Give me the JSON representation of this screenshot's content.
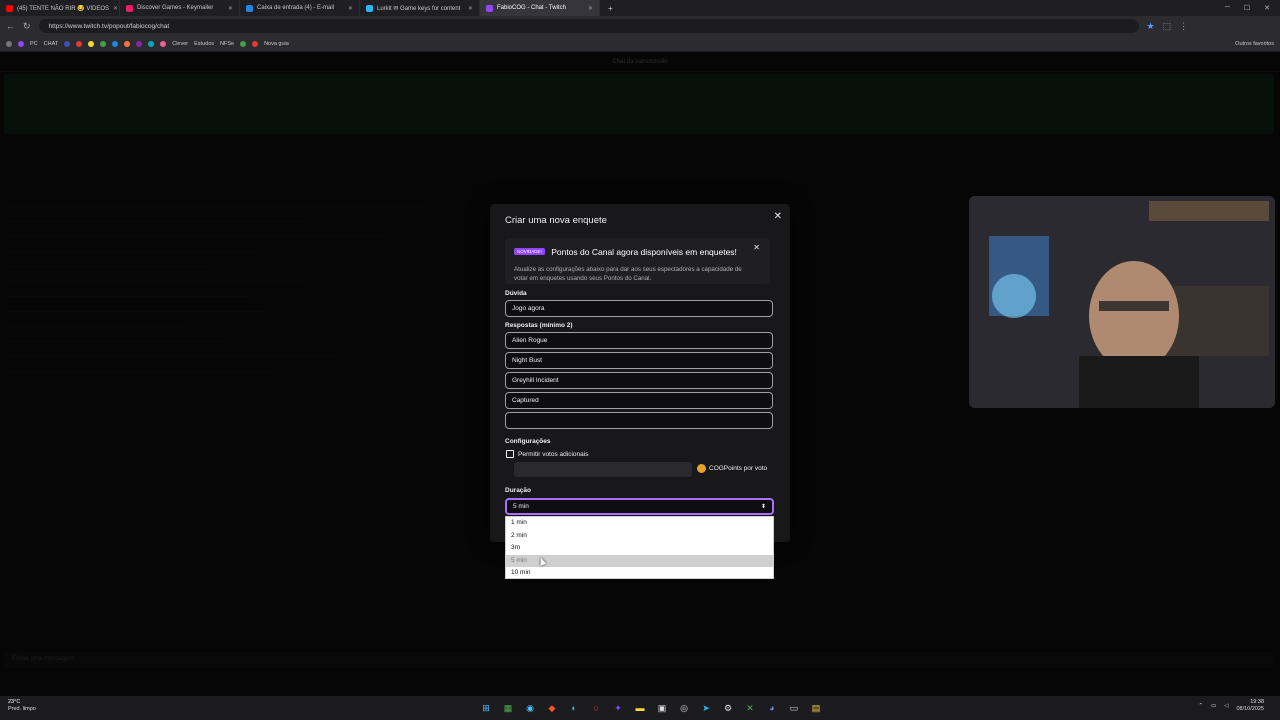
{
  "browser": {
    "tabs": [
      {
        "label": "(45) TENTE NÃO RIR 😂 VIDEOS",
        "color": "#ff0000"
      },
      {
        "label": "Discover Games - Keymailer",
        "color": "#e91e63"
      },
      {
        "label": "Caixa de entrada (4) - E-mail",
        "color": "#1e88e5"
      },
      {
        "label": "Lurkit ✉ Game keys for content",
        "color": "#29b6f6"
      },
      {
        "label": "FabioCOG - Chat - Twitch",
        "color": "#9147ff"
      }
    ],
    "new_tab": "+",
    "url": "https://www.twitch.tv/popout/fabiocog/chat",
    "bookmarks": [
      "PC",
      "CHAT",
      "Clever",
      "Estudos",
      "NFSe",
      "Nova guia"
    ],
    "bookmarks_right": "Outros favoritos"
  },
  "chat": {
    "header": "Chat da transmissão",
    "input_placeholder": "Enviar uma mensagem"
  },
  "modal": {
    "title": "Criar uma nova enquete",
    "close": "✕",
    "promo": {
      "badge": "NOVIDADE!",
      "title": "Pontos do Canal agora disponíveis em enquetes!",
      "description": "Atualize as configurações abaixo para dar aos seus espectadores a capacidade de votar em enquetes usando seus Pontos do Canal.",
      "close": "✕"
    },
    "question_label": "Dúvida",
    "question_value": "Jogo agora",
    "answers_label": "Respostas (mínimo 2)",
    "answers": [
      "Alien Rogue",
      "Night Bust",
      "Greyhill Incident",
      "Captured",
      ""
    ],
    "settings_label": "Configurações",
    "extra_votes_label": "Permitir votos adicionais",
    "points_label": "COGPoints por voto",
    "duration_label": "Duração",
    "duration_value": "5 min",
    "duration_options": [
      "1 min",
      "2 min",
      "3m",
      "5 min",
      "10 min"
    ],
    "hovered_option": "5 min"
  },
  "taskbar": {
    "temperature": "23°C",
    "weather": "Pred. limpo",
    "time": "19:38",
    "date": "08/10/2025"
  },
  "colors": {
    "accent": "#9147ff",
    "focus": "#a970ff",
    "coin": "#e5a32a"
  }
}
